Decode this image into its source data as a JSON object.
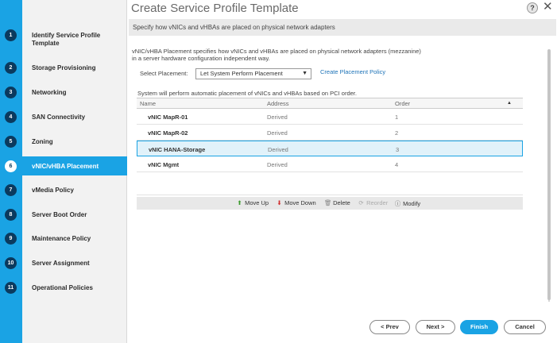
{
  "window": {
    "title": "Create Service Profile Template"
  },
  "steps": [
    {
      "num": "1",
      "label": "Identify Service Profile Template"
    },
    {
      "num": "2",
      "label": "Storage Provisioning"
    },
    {
      "num": "3",
      "label": "Networking"
    },
    {
      "num": "4",
      "label": "SAN Connectivity"
    },
    {
      "num": "5",
      "label": "Zoning"
    },
    {
      "num": "6",
      "label": "vNIC/vHBA Placement"
    },
    {
      "num": "7",
      "label": "vMedia Policy"
    },
    {
      "num": "8",
      "label": "Server Boot Order"
    },
    {
      "num": "9",
      "label": "Maintenance Policy"
    },
    {
      "num": "10",
      "label": "Server Assignment"
    },
    {
      "num": "11",
      "label": "Operational Policies"
    }
  ],
  "active_step": "6",
  "banner": "Specify how vNICs and vHBAs are placed on physical network adapters",
  "description_line1": "vNIC/vHBA Placement specifies how vNICs and vHBAs are placed on physical network adapters (mezzanine)",
  "description_line2": "in a server hardware configuration independent way.",
  "select_placement": {
    "label": "Select Placement:",
    "value": "Let System Perform Placement",
    "link": "Create Placement Policy"
  },
  "system_note": "System will perform automatic placement of vNICs and vHBAs based on PCI order.",
  "table": {
    "headers": {
      "name": "Name",
      "address": "Address",
      "order": "Order"
    },
    "rows": [
      {
        "name": "vNIC MapR-01",
        "address": "Derived",
        "order": "1"
      },
      {
        "name": "vNIC MapR-02",
        "address": "Derived",
        "order": "2"
      },
      {
        "name": "vNIC HANA-Storage",
        "address": "Derived",
        "order": "3"
      },
      {
        "name": "vNIC Mgmt",
        "address": "Derived",
        "order": "4"
      }
    ],
    "selected_row": 2
  },
  "toolbar": {
    "move_up": "Move Up",
    "move_down": "Move Down",
    "delete": "Delete",
    "reorder": "Reorder",
    "modify": "Modify"
  },
  "buttons": {
    "prev": "< Prev",
    "next": "Next >",
    "finish": "Finish",
    "cancel": "Cancel"
  },
  "icons": {
    "help": "?",
    "close": "✕",
    "caret": "▼",
    "sort": "▲",
    "up_arrow": "⬆",
    "down_arrow": "⬇",
    "delete": "🗑",
    "reorder": "⟳",
    "info": "ⓘ"
  },
  "colors": {
    "accent": "#1aa3e4",
    "step_circle": "#0b3a5e",
    "link": "#1f74b8"
  }
}
